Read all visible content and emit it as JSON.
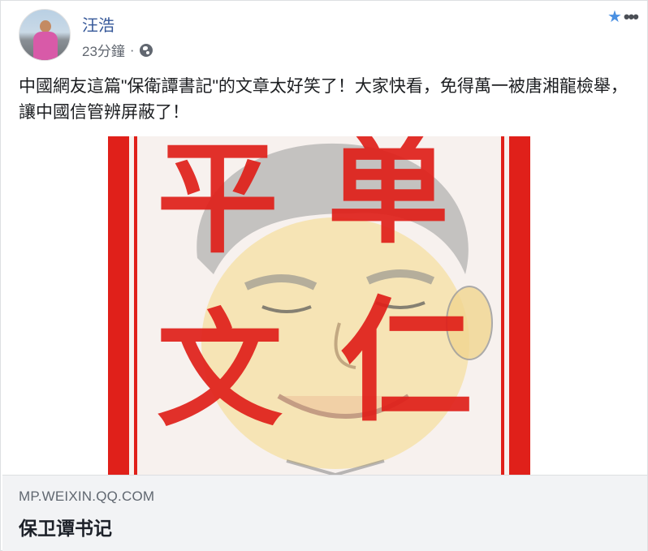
{
  "post": {
    "author": "汪浩",
    "time": "23分鐘",
    "separator": "·",
    "privacy_icon": "globe-icon",
    "star_icon": "star-icon",
    "more_icon": "more-options-icon",
    "more_label": "•••",
    "star_label": "★",
    "text": "中國網友這篇\"保衛譚書記\"的文章太好笑了！大家快看，免得萬一被唐湘龍檢舉，讓中國信管辨屏蔽了！"
  },
  "image": {
    "seal_characters": [
      "平",
      "单",
      "文",
      "仁"
    ],
    "frame_color": "#e0201a"
  },
  "link_preview": {
    "domain": "MP.WEIXIN.QQ.COM",
    "title": "保卫谭书记"
  },
  "colors": {
    "author_link": "#365899",
    "meta_text": "#616770",
    "star": "#4a90e2",
    "footer_bg": "#f2f3f5"
  }
}
